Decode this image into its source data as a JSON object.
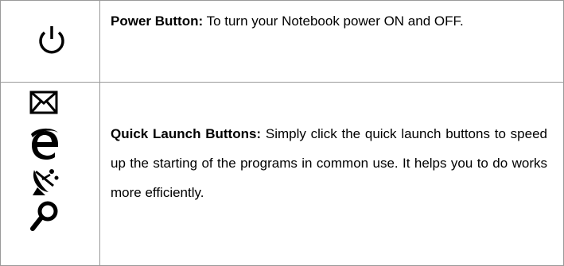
{
  "power": {
    "icon": "power-icon",
    "title": "Power Button:",
    "description": "To turn your Notebook power ON and OFF."
  },
  "quick_launch": {
    "icons": [
      "mail-icon",
      "internet-explorer-icon",
      "satellite-dish-icon",
      "search-icon"
    ],
    "title": "Quick Launch Buttons:",
    "description": "Simply click the quick launch buttons to speed up the starting of the programs in common use. It helps you to do works more efficiently."
  }
}
